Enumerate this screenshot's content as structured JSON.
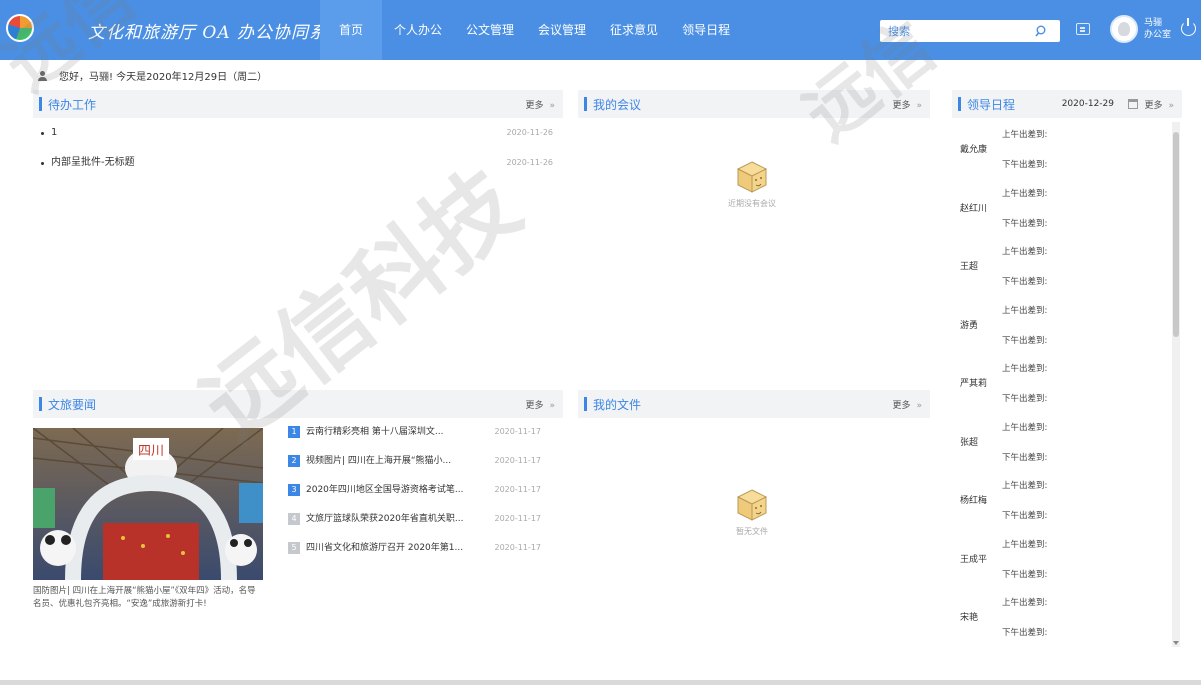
{
  "header": {
    "system_title": "文化和旅游厅 OA 办公协同系统",
    "nav": [
      "首页",
      "个人办公",
      "公文管理",
      "会议管理",
      "征求意见",
      "领导日程"
    ],
    "search_placeholder": "搜索",
    "user_name": "马骊",
    "user_dept": "办公室"
  },
  "greeting": "您好，马骊! 今天是2020年12月29日（周二）",
  "todo": {
    "title": "待办工作",
    "more": "更多",
    "items": [
      {
        "text": "1",
        "date": "2020-11-26"
      },
      {
        "text": "内部呈批件-无标题",
        "date": "2020-11-26"
      }
    ]
  },
  "meetings": {
    "title": "我的会议",
    "more": "更多",
    "empty_text": "近期没有会议"
  },
  "schedule": {
    "title": "领导日程",
    "date": "2020-12-29",
    "more": "更多",
    "am_label": "上午出差到:",
    "pm_label": "下午出差到:",
    "leaders": [
      "戴允康",
      "赵红川",
      "王超",
      "游勇",
      "严其莉",
      "张超",
      "杨红梅",
      "王成平",
      "宋艳"
    ]
  },
  "news": {
    "title": "文旅要闻",
    "more": "更多",
    "image_caption": "国防图片| 四川在上海开展“熊猫小屋”《双年四》活动，名导名员、优惠礼包齐亮相。“安逸”成旅游新打卡!",
    "items": [
      {
        "num": "1",
        "title": "云南行精彩亮相 第十八届深圳文...",
        "date": "2020-11-17",
        "hot": true
      },
      {
        "num": "2",
        "title": "视频图片| 四川在上海开展“熊猫小...",
        "date": "2020-11-17",
        "hot": true
      },
      {
        "num": "3",
        "title": "2020年四川地区全国导游资格考试笔...",
        "date": "2020-11-17",
        "hot": true
      },
      {
        "num": "4",
        "title": "文旅厅篮球队荣获2020年省直机关职...",
        "date": "2020-11-17",
        "hot": false
      },
      {
        "num": "5",
        "title": "四川省文化和旅游厅召开 2020年第1...",
        "date": "2020-11-17",
        "hot": false
      }
    ]
  },
  "files": {
    "title": "我的文件",
    "more": "更多",
    "empty_text": "暂无文件"
  },
  "watermark": [
    "远信科技",
    "远信",
    "远信"
  ],
  "colors": {
    "header_bg": "#4a8fe3",
    "accent": "#3c86e6",
    "panel_head_bg": "#f2f3f5"
  }
}
